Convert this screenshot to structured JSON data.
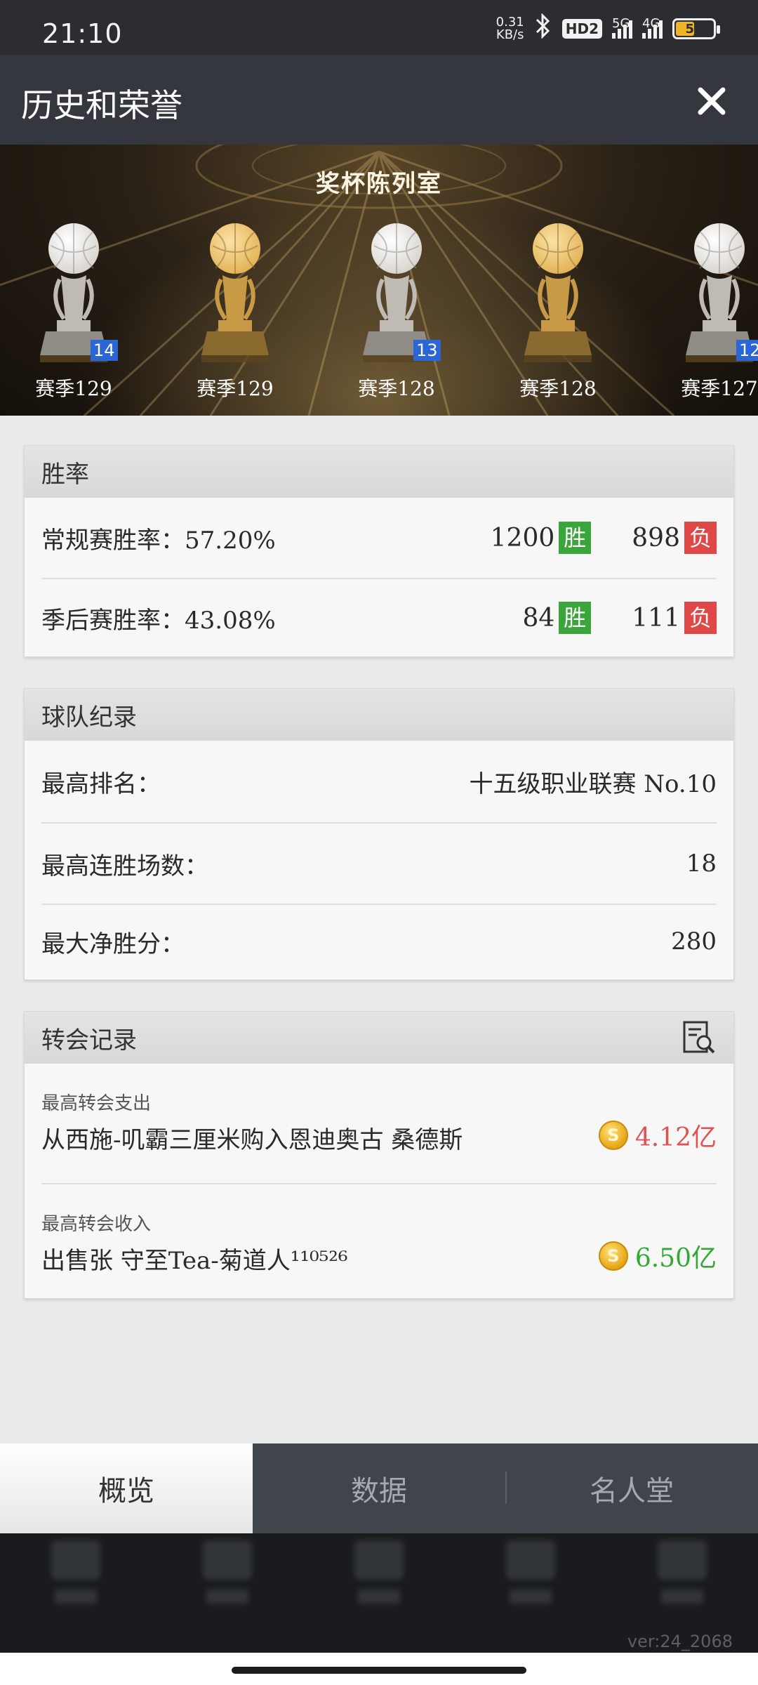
{
  "status_bar": {
    "time": "21:10",
    "net_speed_value": "0.31",
    "net_speed_unit": "KB/s",
    "bluetooth_icon": "bluetooth-icon",
    "hd_badge": "HD2",
    "signal_1": "5G",
    "signal_2": "4G",
    "battery": "54",
    "battery_level": 0.54,
    "battery_color": "#f0b429"
  },
  "header": {
    "title": "历史和荣誉",
    "close_icon": "close-icon"
  },
  "trophy_room": {
    "title": "奖杯陈列室",
    "trophies": [
      {
        "label": "赛季129",
        "material": "silver",
        "count": "14"
      },
      {
        "label": "赛季129",
        "material": "gold",
        "count": ""
      },
      {
        "label": "赛季128",
        "material": "silver",
        "count": "13"
      },
      {
        "label": "赛季128",
        "material": "gold",
        "count": ""
      },
      {
        "label": "赛季127",
        "material": "silver",
        "count": "12"
      }
    ]
  },
  "win_rate": {
    "title": "胜率",
    "regular": {
      "label": "常规赛胜率：57.20%",
      "wins": "1200",
      "losses": "898"
    },
    "playoff": {
      "label": "季后赛胜率：43.08%",
      "wins": "84",
      "losses": "111"
    },
    "win_tag": "胜",
    "loss_tag": "负",
    "win_color": "#3aa53a",
    "loss_color": "#e04848"
  },
  "team_record": {
    "title": "球队纪录",
    "rows": [
      {
        "label": "最高排名：",
        "value": "十五级职业联赛 No.10"
      },
      {
        "label": "最高连胜场数：",
        "value": "18"
      },
      {
        "label": "最大净胜分：",
        "value": "280"
      }
    ]
  },
  "transfer_record": {
    "title": "转会记录",
    "search_icon": "document-search-icon",
    "spend": {
      "caption": "最高转会支出",
      "desc": "从西施-叽霸三厘米购入恩迪奥古 桑德斯",
      "amount": "4.12亿",
      "color": "#e05252"
    },
    "income": {
      "caption": "最高转会收入",
      "desc": "出售张 守至Tea-菊道人¹¹⁰⁵²⁶",
      "amount": "6.50亿",
      "color": "#34a834"
    },
    "coin_symbol": "S"
  },
  "tabs": {
    "overview": "概览",
    "data": "数据",
    "hall_of_fame": "名人堂"
  },
  "version": "ver:24_2068"
}
